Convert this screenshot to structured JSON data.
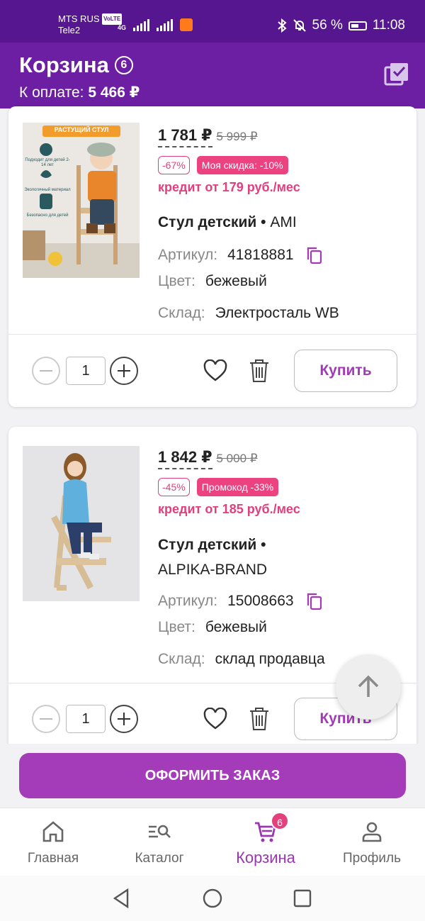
{
  "status_bar": {
    "carrier1": "MTS RUS",
    "carrier1_tag": "VoLTE",
    "carrier2": "Tele2",
    "network": "4G",
    "battery": "56 %",
    "time": "11:08"
  },
  "header": {
    "title": "Корзина",
    "count": "6",
    "pay_label": "К оплате:",
    "pay_amount": "5 466 ₽"
  },
  "products": [
    {
      "price": "1 781",
      "currency": "₽",
      "old_price": "5 999",
      "discount_badge": "-67%",
      "promo_badge": "Моя скидка: -10%",
      "credit": "кредит от 179 руб./мес",
      "name": "Стул детский •",
      "brand": "AMI",
      "article_label": "Артикул:",
      "article": "41818881",
      "color_label": "Цвет:",
      "color": "бежевый",
      "warehouse_label": "Склад:",
      "warehouse": "Электросталь WB",
      "quantity": "1",
      "buy_label": "Купить",
      "image_banner": "РАСТУЩИЙ СТУЛ",
      "image_labels": [
        "Подходит для детей 2-14 лет",
        "Экологичный материал",
        "Безопасно для детей"
      ]
    },
    {
      "price": "1 842",
      "currency": "₽",
      "old_price": "5 000",
      "discount_badge": "-45%",
      "promo_badge": "Промокод -33%",
      "credit": "кредит от 185 руб./мес",
      "name": "Стул детский •",
      "brand": "ALPIKA-BRAND",
      "article_label": "Артикул:",
      "article": "15008663",
      "color_label": "Цвет:",
      "color": "бежевый",
      "warehouse_label": "Склад:",
      "warehouse": "склад продавца",
      "quantity": "1",
      "buy_label": "Купить"
    }
  ],
  "checkout": {
    "label": "ОФОРМИТЬ ЗАКАЗ"
  },
  "bottom_nav": {
    "items": [
      {
        "label": "Главная",
        "icon": "home-icon"
      },
      {
        "label": "Каталог",
        "icon": "catalog-search-icon"
      },
      {
        "label": "Корзина",
        "icon": "cart-icon",
        "badge": "6",
        "active": true
      },
      {
        "label": "Профиль",
        "icon": "profile-icon"
      }
    ]
  },
  "colors": {
    "status_bar": "#55168f",
    "header": "#6c1fa3",
    "accent": "#a43cba",
    "pink": "#ec4280"
  }
}
